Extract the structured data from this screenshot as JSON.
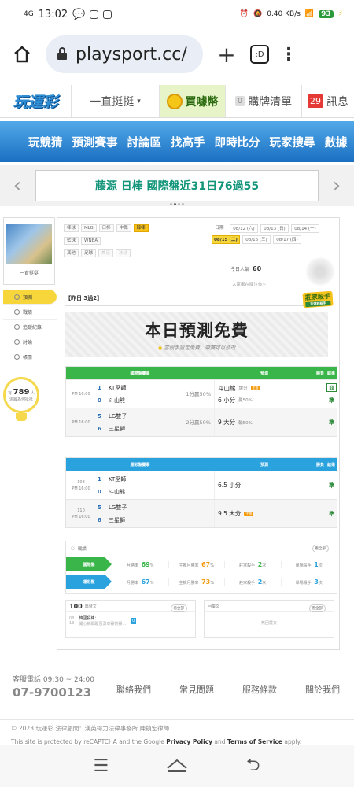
{
  "status": {
    "time": "13:02",
    "network": "4G",
    "speed": "0.40\nKB/s",
    "battery": "93"
  },
  "browser": {
    "url": "playsport.cc/",
    "tabs": ":D"
  },
  "site": {
    "logo": "玩運彩",
    "stay_label": "一直挺挺",
    "buy_label": "買噱幣",
    "cart_count": "0",
    "cart_label": "購牌清單",
    "msg_count": "29",
    "msg_label": "訊息",
    "nav": [
      "玩競猜",
      "預測賽事",
      "討論區",
      "找高手",
      "即時比分",
      "玩家搜尋",
      "數據"
    ],
    "banner": "藤源 日棒 國際盤近31日76過55"
  },
  "sidebar": {
    "name": "一直挺挺",
    "items": [
      "預測",
      "戰績",
      "追蹤紀錄",
      "討論",
      "帳冊"
    ],
    "bulb_prefix": "有",
    "bulb_count": "789",
    "bulb_suffix": "人",
    "bulb_note": "追蹤為何挺挺"
  },
  "filters": {
    "tags": [
      "棒球",
      "MLB",
      "日棒",
      "中職",
      "韓棒",
      "籃球",
      "WNBA",
      "其他",
      "足球",
      "美足",
      "冰球"
    ],
    "date_label": "日期",
    "dates": [
      "08/12 (六)",
      "08/13 (日)",
      "08/14 (一)",
      "08/15 (二)",
      "08/16 (三)",
      "08/17 (四)"
    ]
  },
  "viewers": {
    "label": "今日人氣",
    "count": "60",
    "follow": "大家都在關注你~"
  },
  "yesterday": "【昨日 3過2】",
  "killer": {
    "title": "莊家殺手",
    "sub": "玩運彩殺手"
  },
  "free": {
    "title": "本日預測免費",
    "note": "當殺手設定免費，帶賽可以修改"
  },
  "table1": {
    "headers": [
      "國際盤賽事",
      "預測",
      "勝負",
      "結果"
    ],
    "rows": [
      {
        "time": "PM 16:00",
        "home_no": "1",
        "home": "KT巫師",
        "away_no": "0",
        "away": "斗山熊",
        "extra": "1分贏50%",
        "pick": "斗山熊",
        "pick_sub": "讓分",
        "pick2": "6 小分",
        "pick2_sub": "贏50%",
        "result": "囧"
      },
      {
        "time": "PM 16:00",
        "home_no": "5",
        "home": "LG雙子",
        "away_no": "6",
        "away": "三星獅",
        "extra": "2分贏50%",
        "pick": "",
        "pick_sub": "",
        "pick2": "9 大分",
        "pick2_sub": "輸50%",
        "result": "準"
      }
    ]
  },
  "table2": {
    "headers": [
      "運彩盤賽事",
      "預測",
      "勝負",
      "結果"
    ],
    "rows": [
      {
        "no": "108",
        "time": "PM 16:00",
        "home_no": "1",
        "home": "KT巫師",
        "away_no": "0",
        "away": "斗山熊",
        "pick": "6.5 小分",
        "result": "準"
      },
      {
        "no": "110",
        "time": "PM 16:00",
        "home_no": "5",
        "home": "LG雙子",
        "away_no": "6",
        "away": "三星獅",
        "pick": "9.5 大分",
        "result": "準"
      }
    ]
  },
  "stats": {
    "title": "戰績",
    "more": "看全部",
    "rows": [
      {
        "label": "國際盤",
        "a": "月勝率",
        "av": "69",
        "b": "主推月勝率",
        "bv": "67",
        "c": "莊家殺手",
        "cv": "2",
        "d": "單場殺手",
        "dv": "1"
      },
      {
        "label": "運彩盤",
        "a": "月勝率",
        "av": "67",
        "b": "主推月勝率",
        "bv": "73",
        "c": "莊家殺手",
        "cv": "2",
        "d": "單場殺手",
        "dv": "3"
      }
    ]
  },
  "posts": {
    "count": "100",
    "label": "篇發文",
    "more": "看全部",
    "item_title": "韓國殺棒：",
    "item_text": "開心挑戰蹤預測本賽前賽..."
  },
  "replies": {
    "label": "回覆文",
    "more": "看全部",
    "empty": "無回覆文"
  },
  "footer": {
    "service": "客服電話 09:30 ~ 24:00",
    "phone": "07-9700123",
    "links": [
      "聯絡我們",
      "常見問題",
      "服務條款",
      "關於我們"
    ]
  },
  "legal": {
    "line1": "© 2023 玩運彩 法律顧問：漢英得力法律事務所 陳鎮宏律師",
    "line2a": "This site is protected by reCAPTCHA and the Google",
    "pp": "Privacy Policy",
    "and": "and",
    "tos": "Terms of Service",
    "apply": "apply."
  }
}
